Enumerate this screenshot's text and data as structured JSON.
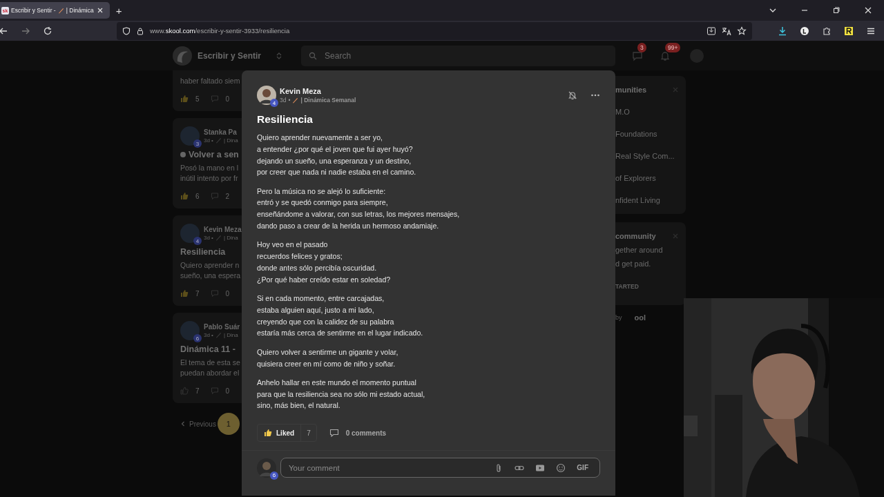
{
  "browser": {
    "tabs": [
      {
        "favicon": "sk",
        "title_before": "Escribir y Sentir -",
        "title_after": "| Dinámica",
        "selected": true
      }
    ],
    "new_tab": "+",
    "url": "www.**skool.com**/escribir-y-sentir-3933/resiliencia"
  },
  "header": {
    "community": "Escribir y Sentir",
    "search": {
      "placeholder": "Search"
    },
    "chat_badge": "3",
    "notification_badge": "99+"
  },
  "feed": [
    {
      "body": [
        "haber faltado siem"
      ],
      "likes": "5",
      "comments": "0",
      "liked": true
    },
    {
      "author": "Stanka Pa",
      "level": "3",
      "meta": "3d •",
      "category": "| Dina",
      "title": "Volver a sen",
      "title_dot": true,
      "body": [
        "Posó la mano en l",
        "inútil intento por fr"
      ],
      "likes": "6",
      "comments": "2",
      "liked": true
    },
    {
      "author": "Kevin Meza",
      "level": "4",
      "meta": "3d •",
      "category": "| Dina",
      "title": "Resiliencia",
      "body": [
        "Quiero aprender n",
        "sueño, una espera"
      ],
      "likes": "7",
      "comments": "0",
      "liked": true
    },
    {
      "author": "Pablo Suár",
      "level": "6",
      "meta": "3d •",
      "category": "| Dina",
      "title": "Dinámica 11 -",
      "body": [
        "El tema de esta se",
        "puedan abordar el"
      ],
      "likes": "7",
      "comments": "0",
      "liked": false
    }
  ],
  "pagination": {
    "previous": "Previous",
    "pages": [
      {
        "label": "1",
        "selected": true
      }
    ]
  },
  "sidebar": {
    "cards": [
      {
        "title": "munities",
        "items": [
          "M.O",
          "Foundations",
          "Real Style Com...",
          "of Explorers",
          "nfident Living"
        ]
      },
      {
        "title": "community",
        "body": [
          "gether around",
          "d get paid."
        ],
        "button": "TARTED"
      }
    ],
    "footer": {
      "by": "by",
      "logo": "ool"
    }
  },
  "post": {
    "author": "Kevin Meza",
    "level": "4",
    "age": "3d",
    "separator": "•",
    "category": "| Dinámica Semanal",
    "title": "Resiliencia",
    "stanzas": [
      [
        "Quiero aprender nuevamente a ser yo,",
        "a entender ¿por qué el joven que fui ayer huyó?",
        "dejando un sueño, una esperanza y un destino,",
        "por creer que nada ni nadie estaba en el camino."
      ],
      [
        "Pero la música no se alejó lo suficiente:",
        "entró y se quedó conmigo para siempre,",
        "enseñándome a valorar, con sus letras, los mejores mensajes,",
        "dando paso a crear de la herida un hermoso andamiaje."
      ],
      [
        "Hoy veo en el pasado",
        "recuerdos felices y gratos;",
        "donde antes sólo percibía oscuridad.",
        "¿Por qué haber creído estar en soledad?"
      ],
      [
        "Si en cada momento, entre carcajadas,",
        "estaba alguien aquí, justo a mi lado,",
        "creyendo que con la calidez de su palabra",
        "estaría más cerca de sentirme en el lugar indicado."
      ],
      [
        "Quiero volver a sentirme un gigante y volar,",
        "quisiera creer en mí como de niño y soñar."
      ],
      [
        "Anhelo hallar en este mundo el momento puntual",
        "para que la resiliencia sea no sólo mi estado actual,",
        "sino, más bien, el natural."
      ]
    ],
    "like": {
      "label": "Liked",
      "liked": true,
      "count": "7"
    },
    "comments": "0 comments",
    "comment_box": {
      "level": "6",
      "placeholder": "Your comment",
      "gif": "GIF"
    }
  }
}
